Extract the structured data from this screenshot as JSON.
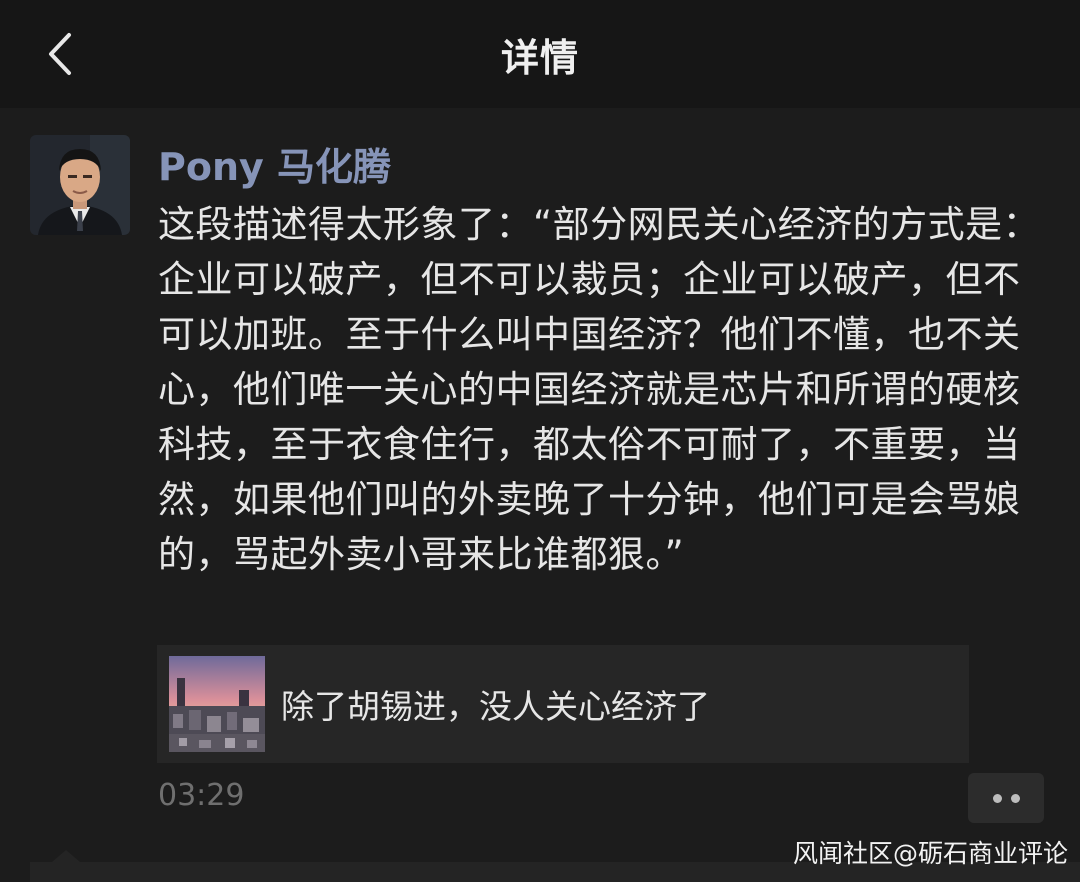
{
  "header": {
    "title": "详情",
    "back_icon": "chevron-left-icon"
  },
  "post": {
    "author": "Pony 马化腾",
    "text": "这段描述得太形象了：“部分网民关心经济的方式是：企业可以破产，但不可以裁员；企业可以破产，但不可以加班。至于什么叫中国经济？他们不懂，也不关心，他们唯一关心的中国经济就是芯片和所谓的硬核科技，至于衣食住行，都太俗不可耐了，不重要，当然，如果他们叫的外卖晚了十分钟，他们可是会骂娘的，骂起外卖小哥来比谁都狠。”",
    "link": {
      "title": "除了胡锡进，没人关心经济了"
    },
    "time": "03:29",
    "more_icon": "more-dots-icon"
  },
  "watermark": "风闻社区@砺石商业评论",
  "colors": {
    "background": "#1c1c1c",
    "topbar": "#161616",
    "author_name": "#8694b8",
    "text": "#e6e6e6",
    "timestamp": "#6f6f6f",
    "card": "#262626"
  }
}
